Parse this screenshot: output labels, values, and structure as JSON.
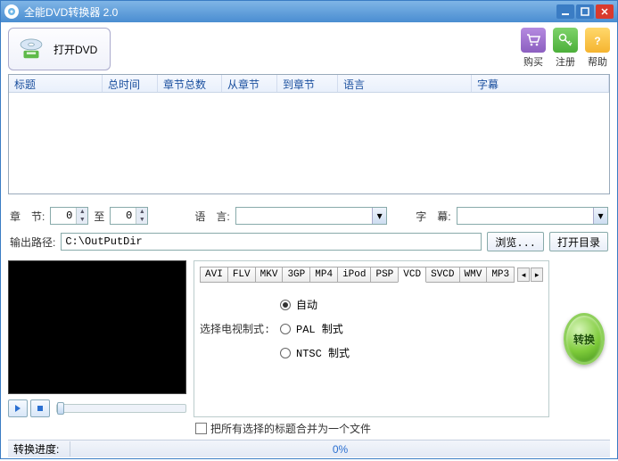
{
  "window": {
    "title": "全能DVD转换器 2.0"
  },
  "toolbar": {
    "open_dvd": "打开DVD",
    "buy": "购买",
    "register": "注册",
    "help": "帮助"
  },
  "list_columns": {
    "title": "标题",
    "total_time": "总时间",
    "chapter_count": "章节总数",
    "from_chapter": "从章节",
    "to_chapter": "到章节",
    "language": "语言",
    "subtitle": "字幕"
  },
  "chapter_row": {
    "label": "章　节:",
    "from": "0",
    "to_label": "至",
    "to": "0",
    "lang_label": "语　言:",
    "lang_value": "",
    "sub_label": "字　幕:",
    "sub_value": ""
  },
  "output_row": {
    "label": "输出路径:",
    "path": "C:\\OutPutDir",
    "browse": "浏览...",
    "open_dir": "打开目录"
  },
  "format_tabs": [
    "AVI",
    "FLV",
    "MKV",
    "3GP",
    "MP4",
    "iPod",
    "PSP",
    "VCD",
    "SVCD",
    "WMV",
    "MP3"
  ],
  "format_selected": "VCD",
  "tv_system": {
    "label": "选择电视制式:",
    "auto": "自动",
    "pal": "PAL  制式",
    "ntsc": "NTSC 制式",
    "selected": "auto"
  },
  "convert_label": "转换",
  "merge_checkbox_label": "把所有选择的标题合并为一个文件",
  "progress": {
    "label": "转换进度:",
    "value": "0%"
  }
}
